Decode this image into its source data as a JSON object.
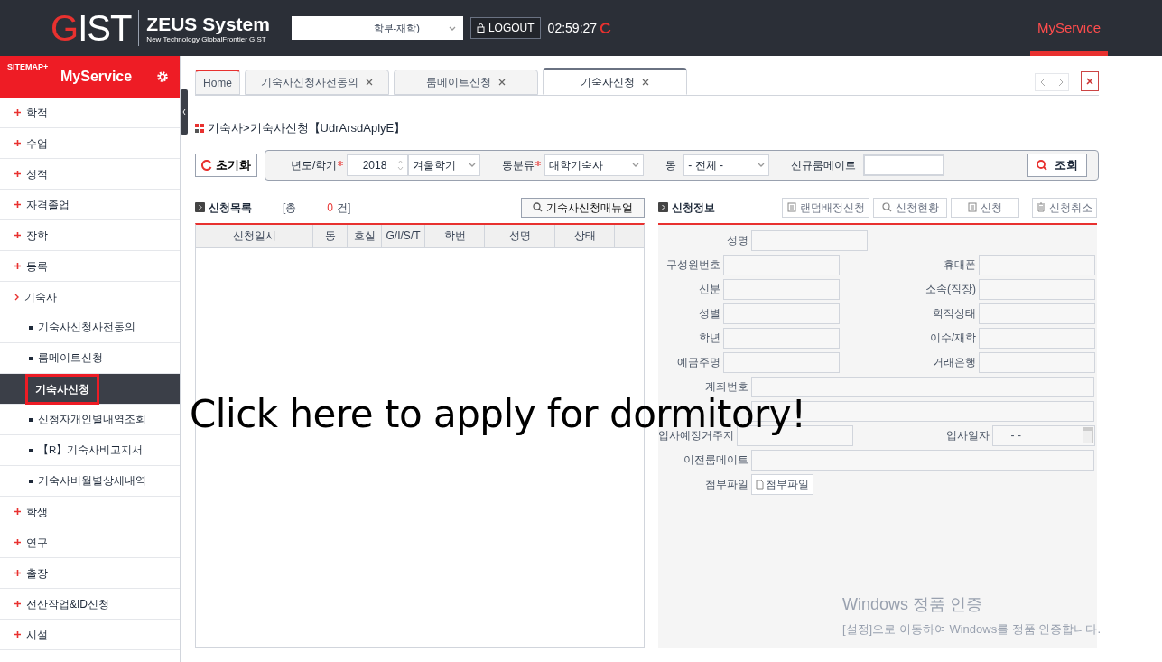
{
  "header": {
    "logo": "GIST",
    "system_title": "ZEUS System",
    "system_subtitle": "New Technology GlobalFrontier GIST",
    "user_select": "학부-재학)",
    "logout_button": "LOGOUT",
    "timer": "02:59:27",
    "nav": [
      {
        "label": "MyService",
        "selected": true
      }
    ]
  },
  "sidebar": {
    "sitemap": "SITEMAP+",
    "title": "MyService",
    "items": [
      {
        "label": "학적",
        "expanded": false
      },
      {
        "label": "수업",
        "expanded": false
      },
      {
        "label": "성적",
        "expanded": false
      },
      {
        "label": "자격졸업",
        "expanded": false
      },
      {
        "label": "장학",
        "expanded": false
      },
      {
        "label": "등록",
        "expanded": false
      },
      {
        "label": "기숙사",
        "expanded": true,
        "children": [
          {
            "label": "기숙사신청사전동의",
            "selected": false
          },
          {
            "label": "룸메이트신청",
            "selected": false
          },
          {
            "label": "기숙사신청",
            "selected": true
          },
          {
            "label": "신청자개인별내역조회",
            "selected": false
          },
          {
            "label": "【R】기숙사비고지서",
            "selected": false
          },
          {
            "label": "기숙사비월별상세내역",
            "selected": false
          }
        ]
      },
      {
        "label": "학생",
        "expanded": false
      },
      {
        "label": "연구",
        "expanded": false
      },
      {
        "label": "출장",
        "expanded": false
      },
      {
        "label": "전산작업&ID신청",
        "expanded": false
      },
      {
        "label": "시설",
        "expanded": false
      }
    ]
  },
  "tabs": [
    {
      "label": "Home",
      "closable": false,
      "selected": false
    },
    {
      "label": "기숙사신청사전동의",
      "closable": true,
      "selected": false
    },
    {
      "label": "룸메이트신청",
      "closable": true,
      "selected": false
    },
    {
      "label": "기숙사신청",
      "closable": true,
      "selected": true
    }
  ],
  "breadcrumb": "기숙사>기숙사신청【UdrArsdAplyE】",
  "filter": {
    "reset_button": "초기화",
    "year_label": "년도/학기",
    "year_required": true,
    "building_type_required": true,
    "year": "2018",
    "term": "겨울학기",
    "building_type_label": "동분류",
    "building_type": "대학기숙사",
    "building_label": "동",
    "building": "- 전체 -",
    "roommate_label": "신규룸메이트",
    "search_button": "조회"
  },
  "list": {
    "title": "신청목록",
    "count_prefix": "[총",
    "count": "0",
    "count_suffix": "건]",
    "manual_button": "기숙사신청매뉴얼",
    "columns": [
      "신청일시",
      "동",
      "호실",
      "G/I/S/T",
      "학번",
      "성명",
      "상태"
    ]
  },
  "info": {
    "title": "신청정보",
    "buttons": [
      {
        "label": "랜덤배정신청",
        "kind": "doc"
      },
      {
        "label": "신청현황",
        "kind": "search"
      },
      {
        "label": "신청",
        "kind": "doc"
      },
      {
        "label": "신청취소",
        "kind": "trash"
      }
    ],
    "rows": [
      [
        {
          "label": "성명",
          "kind": "text"
        }
      ],
      [
        {
          "label": "구성원번호",
          "kind": "text"
        },
        {
          "label": "휴대폰",
          "kind": "text"
        }
      ],
      [
        {
          "label": "신분",
          "kind": "text"
        },
        {
          "label": "소속(직장)",
          "kind": "text"
        }
      ],
      [
        {
          "label": "성별",
          "kind": "text"
        },
        {
          "label": "학적상태",
          "kind": "text"
        }
      ],
      [
        {
          "label": "학년",
          "kind": "text"
        },
        {
          "label": "이수/재학",
          "kind": "text"
        }
      ],
      [
        {
          "label": "예금주명",
          "kind": "text"
        },
        {
          "label": "거래은행",
          "kind": "text"
        }
      ],
      [
        {
          "label": "계좌번호",
          "kind": "wide"
        }
      ],
      [
        {
          "kind": "wide"
        }
      ],
      [
        {
          "label": "입사예정거주지",
          "kind": "text"
        },
        {
          "label": "입사일자",
          "kind": "date",
          "value": "- -"
        }
      ],
      [
        {
          "label": "이전룸메이트",
          "kind": "wide"
        }
      ],
      [
        {
          "label": "첨부파일",
          "kind": "file",
          "value": "첨부파일"
        }
      ]
    ]
  },
  "annotation": "Click here to apply for dormitory!",
  "windows_notice": {
    "title": "Windows 정품 인증",
    "text": "[설정]으로 이동하여 Windows를 정품 인증합니다."
  }
}
